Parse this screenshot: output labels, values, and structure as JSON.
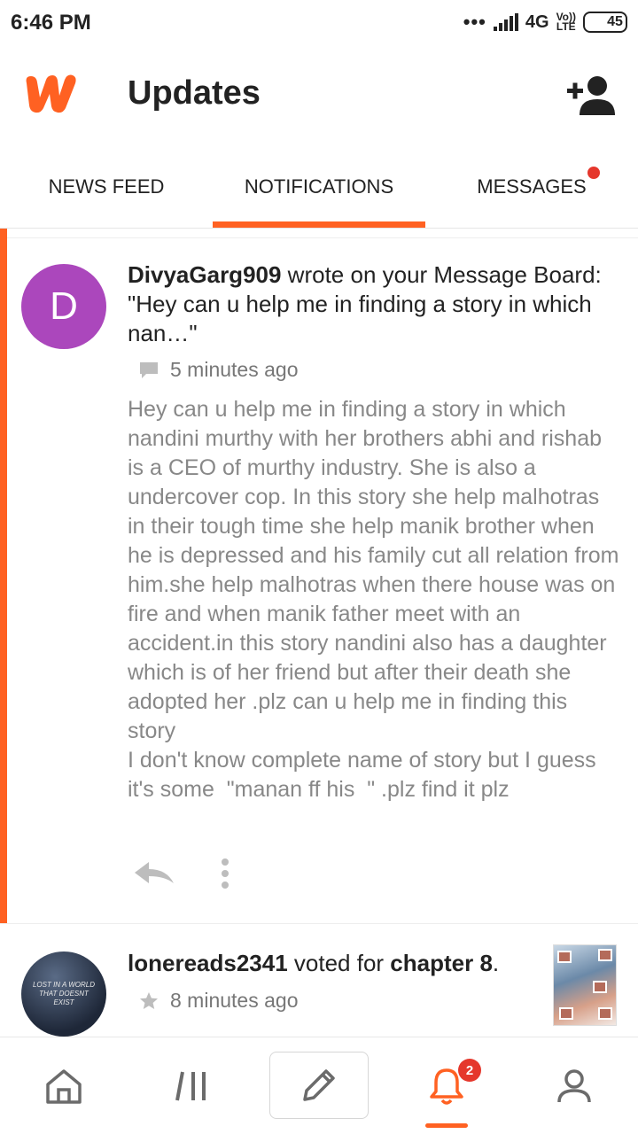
{
  "status_bar": {
    "time": "6:46 PM",
    "network": "4G",
    "volte_top": "Vo))",
    "volte_bottom": "LTE",
    "battery": "45"
  },
  "header": {
    "title": "Updates",
    "logo_icon": "wattpad-logo",
    "add_user_icon": "add-user-icon"
  },
  "tabs": [
    {
      "label": "NEWS FEED",
      "active": false
    },
    {
      "label": "NOTIFICATIONS",
      "active": true
    },
    {
      "label": "MESSAGES",
      "active": false
    }
  ],
  "notifications": [
    {
      "avatar_letter": "D",
      "user": "DivyaGarg909",
      "action": " wrote on your Message Board: \"Hey can u help me in finding a story in which nan…\"",
      "time": "5 minutes ago",
      "body": "Hey can u help me in finding a story in which nandini murthy with her brothers abhi and rishab is a CEO of murthy industry. She is also a undercover cop. In this story she help malhotras in their tough time she help manik brother when he is depressed and his family cut all relation from him.she help malhotras when there house was on fire and when manik father meet with an accident.in this story nandini also has a daughter which is of her friend but after their death she adopted her .plz can u help me in finding this story\nI don't know complete name of story but I guess it's some  \"manan ff his  \" .plz find it plz"
    },
    {
      "avatar_text": "LOST IN A WORLD THAT DOESNT EXIST",
      "user": "lonereads2341",
      "action": " voted for ",
      "target": "chapter 8",
      "end": ".",
      "time": "8 minutes ago"
    }
  ],
  "bottom_nav": {
    "badge": "2",
    "accent": "#ff6122"
  },
  "colors": {
    "accent": "#ff6122",
    "avatar_purple": "#ab47bc",
    "badge_red": "#e5372c"
  }
}
